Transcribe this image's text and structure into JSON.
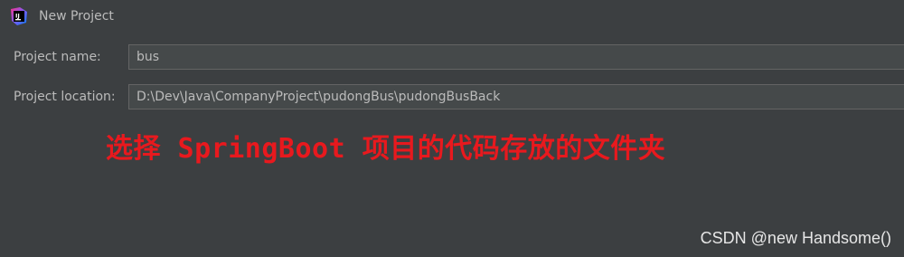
{
  "window": {
    "title": "New Project",
    "icon": "intellij-idea-icon"
  },
  "form": {
    "project_name": {
      "label": "Project name:",
      "value": "bus"
    },
    "project_location": {
      "label": "Project location:",
      "value": "D:\\Dev\\Java\\CompanyProject\\pudongBus\\pudongBusBack"
    }
  },
  "annotation": {
    "text": "选择 SpringBoot 项目的代码存放的文件夹",
    "color": "#e8191e"
  },
  "watermark": {
    "text": "CSDN @new Handsome()"
  },
  "colors": {
    "background": "#3c3f41",
    "field_background": "#45494a",
    "text": "#bbbbbb"
  }
}
